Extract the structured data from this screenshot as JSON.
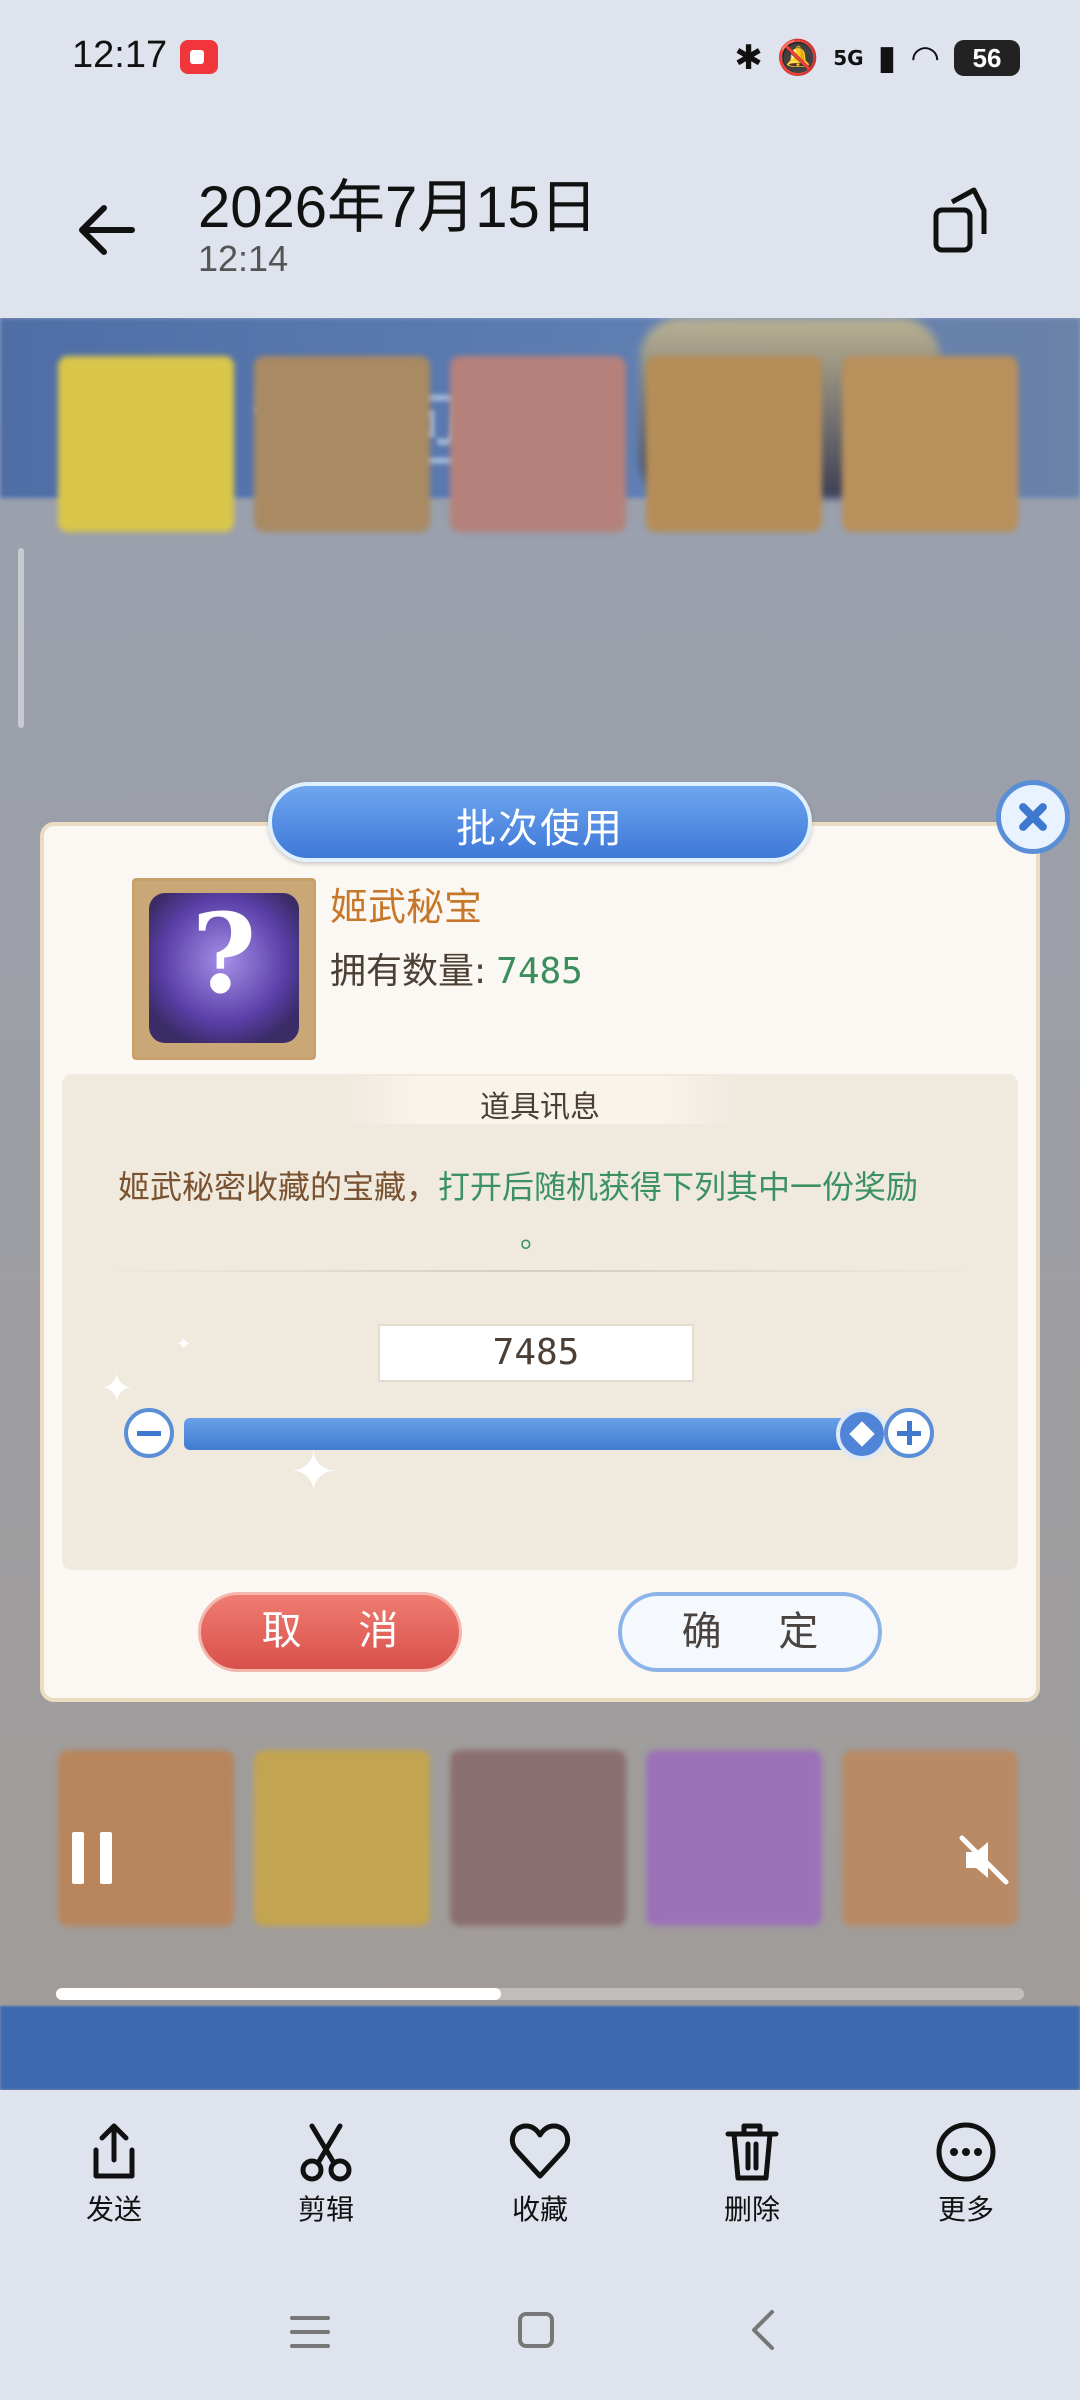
{
  "status_bar": {
    "time": "12:17",
    "network": "5G",
    "battery": "56"
  },
  "header": {
    "title": "2026年7月15日",
    "subtitle": "12:14"
  },
  "game": {
    "banner_title": "背包",
    "dialog": {
      "title": "批次使用",
      "item_name": "姬武秘宝",
      "count_label": "拥有数量:",
      "count_value": "7485",
      "info_heading": "道具讯息",
      "desc_plain": "姬武秘密收藏的宝藏，",
      "desc_highlight": "打开后随机获得下列其中一份奖励",
      "desc_end": "。",
      "quantity_value": "7485",
      "slider_fraction": 1.0,
      "cancel_label": "取 消",
      "confirm_label": "确 定"
    }
  },
  "video": {
    "progress_fraction": 0.46
  },
  "actions": [
    {
      "label": "发送",
      "icon": "share-icon"
    },
    {
      "label": "剪辑",
      "icon": "scissors-icon"
    },
    {
      "label": "收藏",
      "icon": "heart-icon"
    },
    {
      "label": "删除",
      "icon": "trash-icon"
    },
    {
      "label": "更多",
      "icon": "more-icon"
    }
  ],
  "colors": {
    "accent_blue": "#3f78cf",
    "cancel_red": "#d8504a",
    "highlight_green": "#3b9160",
    "item_name_orange": "#c7772a"
  }
}
